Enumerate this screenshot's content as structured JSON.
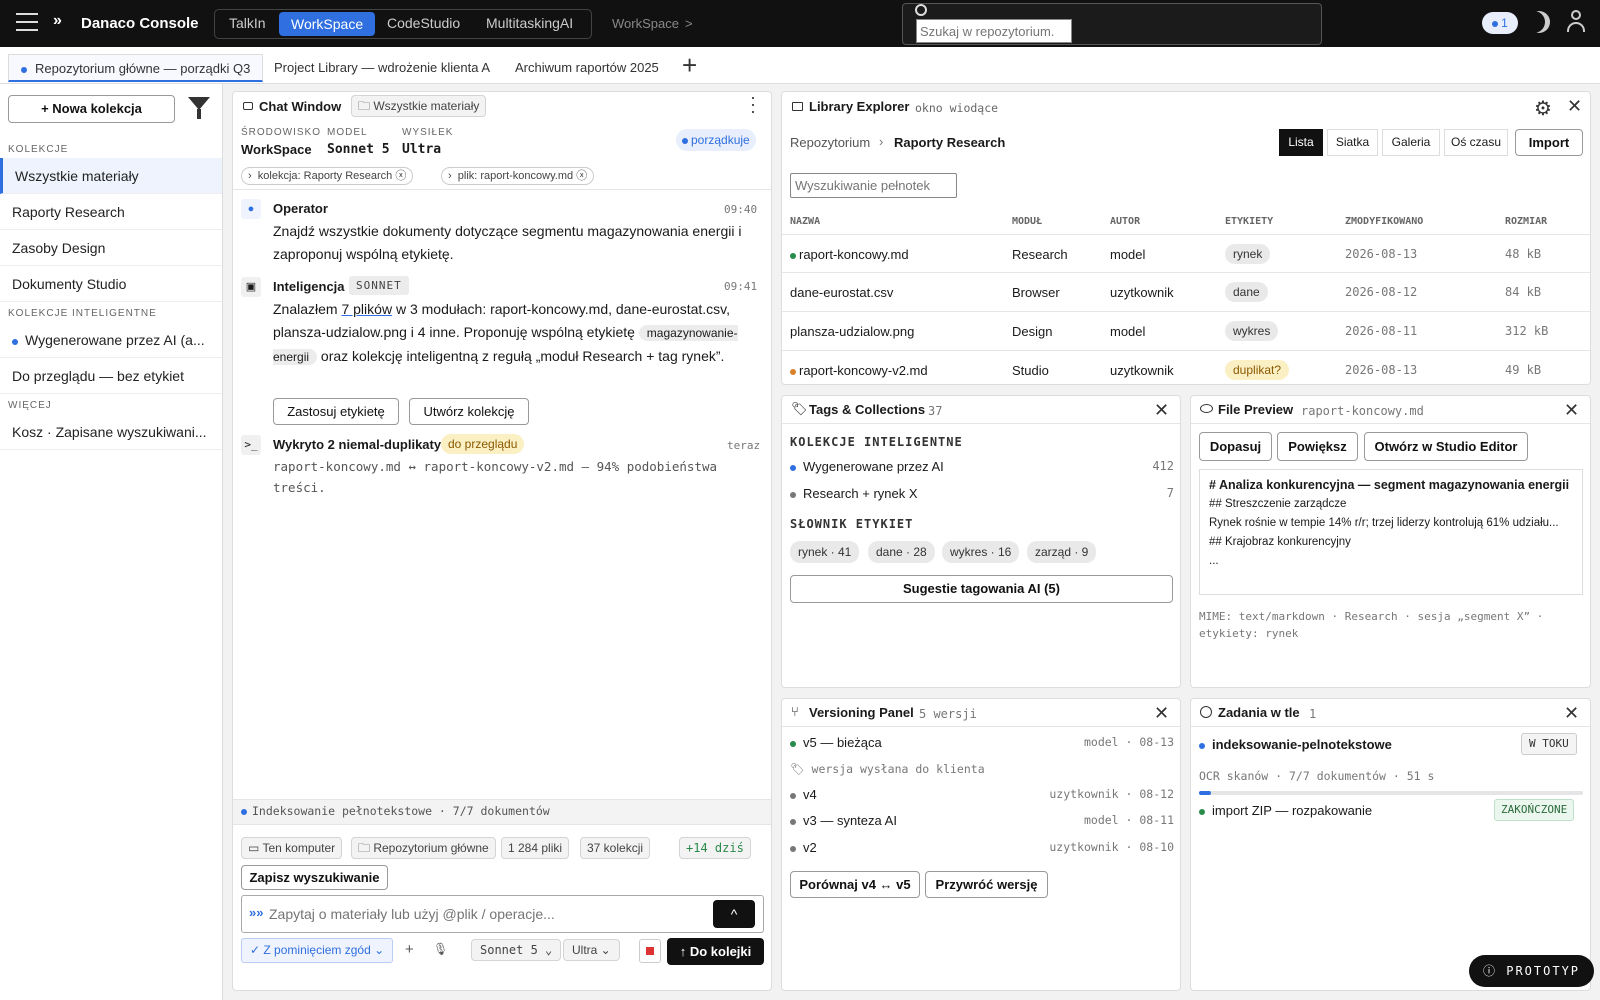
{
  "app": {
    "title": "Danaco Console",
    "modes": [
      "TalkIn",
      "WorkSpace",
      "CodeStudio",
      "MultitaskingAI"
    ],
    "active_mode": "WorkSpace",
    "breadcrumb": "WorkSpace",
    "breadcrumb_sep": ">",
    "search_placeholder": "Szukaj w repozytorium.",
    "notif_count": "1"
  },
  "tabs": [
    "Repozytorium główne — porządki Q3",
    "Project Library — wdrożenie klienta A",
    "Archiwum raportów 2025"
  ],
  "sidebar": {
    "new_button": "+ Nowa kolekcja",
    "section1": "KOLEKCJE",
    "items1": [
      "Wszystkie materiały",
      "Raporty Research",
      "Zasoby Design",
      "Dokumenty Studio"
    ],
    "section2": "KOLEKCJE INTELIGENTNE",
    "items2": [
      "Wygenerowane przez AI (a...",
      "Do przeglądu — bez etykiet"
    ],
    "section3": "WIĘCEJ",
    "items3": [
      "Kosz · Zapisane wyszukiwani..."
    ]
  },
  "chat": {
    "title": "Chat Window",
    "scope": "Wszystkie materiały",
    "env_label": "ŚRODOWISKO",
    "env": "WorkSpace",
    "model_label": "MODEL",
    "model": "Sonnet 5",
    "effort_label": "WYSIŁEK",
    "effort": "Ultra",
    "status": "porządkuje",
    "ctx1": "kolekcja: Raporty Research",
    "ctx2": "plik: raport-koncowy.md",
    "m1_author": "Operator",
    "m1_time": "09:40",
    "m1_text": "Znajdź wszystkie dokumenty dotyczące segmentu magazynowania energii i zaproponuj wspólną etykietę.",
    "m2_author": "Inteligencja",
    "m2_badge": "SONNET",
    "m2_time": "09:41",
    "m2_a": "Znalazłem ",
    "m2_link": "7 plików",
    "m2_b": " w 3 modułach: raport-koncowy.md, dane-eurostat.csv, plansza-udzialow.png i 4 inne. Proponuję wspólną etykietę ",
    "m2_tag": "magazynowanie-energii",
    "m2_c": " oraz kolekcję inteligentną z regułą „moduł Research + tag rynek”.",
    "btn_apply": "Zastosuj etykietę",
    "btn_create": "Utwórz kolekcję",
    "m3_title": "Wykryto 2 niemal-duplikaty",
    "m3_badge": "do przeglądu",
    "m3_time": "teraz",
    "m3_text": "raport-koncowy.md ↔ raport-koncowy-v2.md — 94% podobieństwa treści.",
    "index_status": "Indeksowanie pełnotekstowe · 7/7 dokumentów",
    "f1": "Ten komputer",
    "f2": "Repozytorium główne",
    "f3": "1 284 pliki",
    "f4": "37 kolekcji",
    "f5": "+14 dziś",
    "save_search": "Zapisz wyszukiwanie",
    "input_placeholder": "Zapytaj o materiały lub użyj @plik / operacje...",
    "perm": "Z pominięciem zgód",
    "model_sel": "Sonnet 5",
    "effort_sel": "Ultra",
    "send": "↑ Do kolejki"
  },
  "library": {
    "title": "Library Explorer",
    "subtitle": "okno wiodące",
    "crumb1": "Repozytorium",
    "crumb2": "Raporty Research",
    "views": [
      "Lista",
      "Siatka",
      "Galeria",
      "Oś czasu"
    ],
    "import": "Import",
    "search_placeholder": "Wyszukiwanie pełnotek",
    "headers": [
      "NAZWA",
      "MODUŁ",
      "AUTOR",
      "ETYKIETY",
      "ZMODYFIKOWANO",
      "ROZMIAR"
    ],
    "rows": [
      [
        "raport-koncowy.md",
        "Research",
        "model",
        "rynek",
        "2026-08-13",
        "48 kB"
      ],
      [
        "dane-eurostat.csv",
        "Browser",
        "uzytkownik",
        "dane",
        "2026-08-12",
        "84 kB"
      ],
      [
        "plansza-udzialow.png",
        "Design",
        "model",
        "wykres",
        "2026-08-11",
        "312 kB"
      ],
      [
        "raport-koncowy-v2.md",
        "Studio",
        "uzytkownik",
        "duplikat?",
        "2026-08-13",
        "49 kB"
      ]
    ]
  },
  "tags": {
    "title": "Tags & Collections",
    "count": "37",
    "smart_label": "KOLEKCJE INTELIGENTNE",
    "smart": [
      [
        "Wygenerowane przez AI",
        "412"
      ],
      [
        "Research + rynek X",
        "7"
      ]
    ],
    "dict_label": "SŁOWNIK ETYKIET",
    "dict": [
      "rynek · 41",
      "dane · 28",
      "wykres · 16",
      "zarząd · 9"
    ],
    "ai_btn": "Sugestie tagowania AI (5)"
  },
  "preview": {
    "title": "File Preview",
    "file": "raport-koncowy.md",
    "b1": "Dopasuj",
    "b2": "Powiększ",
    "b3": "Otwórz w Studio Editor",
    "h1": "# Analiza konkurencyjna — segment magazynowania energii",
    "l1": "## Streszczenie zarządcze",
    "l2": "Rynek rośnie w tempie 14% r/r; trzej liderzy kontrolują 61% udziału...",
    "l3": "## Krajobraz konkurencyjny",
    "l4": "...",
    "meta": "MIME: text/markdown · Research · sesja „segment X” · etykiety: rynek"
  },
  "versions": {
    "title": "Versioning Panel",
    "count": "5 wersji",
    "items": [
      [
        "v5 — bieżąca",
        "model · 08-13"
      ],
      [
        "v4",
        "uzytkownik · 08-12"
      ],
      [
        "v3 — synteza AI",
        "model · 08-11"
      ],
      [
        "v2",
        "uzytkownik · 08-10"
      ]
    ],
    "note": "🏷 wersja wysłana do klienta",
    "b1": "Porównaj v4 ↔ v5",
    "b2": "Przywróć wersję"
  },
  "jobs": {
    "title": "Zadania w tle",
    "count": "1",
    "j1": "indeksowanie-pelnotekstowe",
    "j1_status": "W TOKU",
    "j1_detail": "OCR skanów · 7/7 dokumentów · 51 s",
    "j1_progress": 0.03,
    "j2": "import ZIP — rozpakowanie",
    "j2_status": "ZAKOŃCZONE"
  },
  "prototype": "PROTOTYP",
  "colors": {
    "accent": "#2f6fe0",
    "green": "#2a8a4a",
    "orange": "#d9822b",
    "warn_bg": "#fbefc4"
  }
}
